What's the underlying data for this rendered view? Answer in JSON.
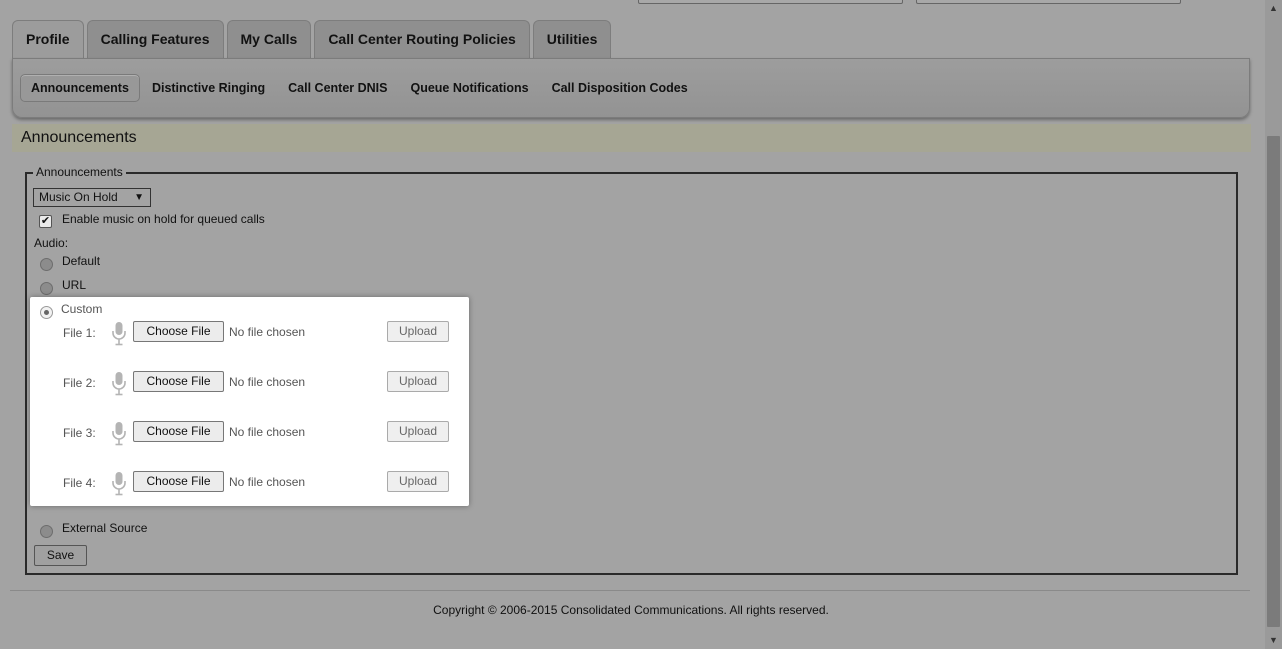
{
  "tabs": [
    {
      "label": "Profile",
      "active": true
    },
    {
      "label": "Calling Features",
      "active": false
    },
    {
      "label": "My Calls",
      "active": false
    },
    {
      "label": "Call Center Routing Policies",
      "active": false
    },
    {
      "label": "Utilities",
      "active": false
    }
  ],
  "subtabs": [
    {
      "label": "Announcements",
      "active": true
    },
    {
      "label": "Distinctive Ringing",
      "active": false
    },
    {
      "label": "Call Center DNIS",
      "active": false
    },
    {
      "label": "Queue Notifications",
      "active": false
    },
    {
      "label": "Call Disposition Codes",
      "active": false
    }
  ],
  "section": {
    "title": "Announcements"
  },
  "fieldset": {
    "legend": "Announcements",
    "select_value": "Music On Hold",
    "enable_checkbox": {
      "label": "Enable music on hold for queued calls",
      "checked": true
    },
    "audio_label": "Audio:",
    "radios": {
      "default": "Default",
      "url": "URL",
      "custom": "Custom",
      "external": "External Source"
    },
    "selected_radio": "Custom",
    "files": [
      {
        "label": "File 1:",
        "choose": "Choose File",
        "status": "No file chosen",
        "upload": "Upload"
      },
      {
        "label": "File 2:",
        "choose": "Choose File",
        "status": "No file chosen",
        "upload": "Upload"
      },
      {
        "label": "File 3:",
        "choose": "Choose File",
        "status": "No file chosen",
        "upload": "Upload"
      },
      {
        "label": "File 4:",
        "choose": "Choose File",
        "status": "No file chosen",
        "upload": "Upload"
      }
    ],
    "save_label": "Save"
  },
  "footer": {
    "copyright": "Copyright © 2006-2015 Consolidated Communications. All rights reserved."
  },
  "icons": {
    "mic": "microphone-icon",
    "select_arrow": "▼",
    "check": "✔",
    "scroll_up": "▲",
    "scroll_down": "▼"
  }
}
